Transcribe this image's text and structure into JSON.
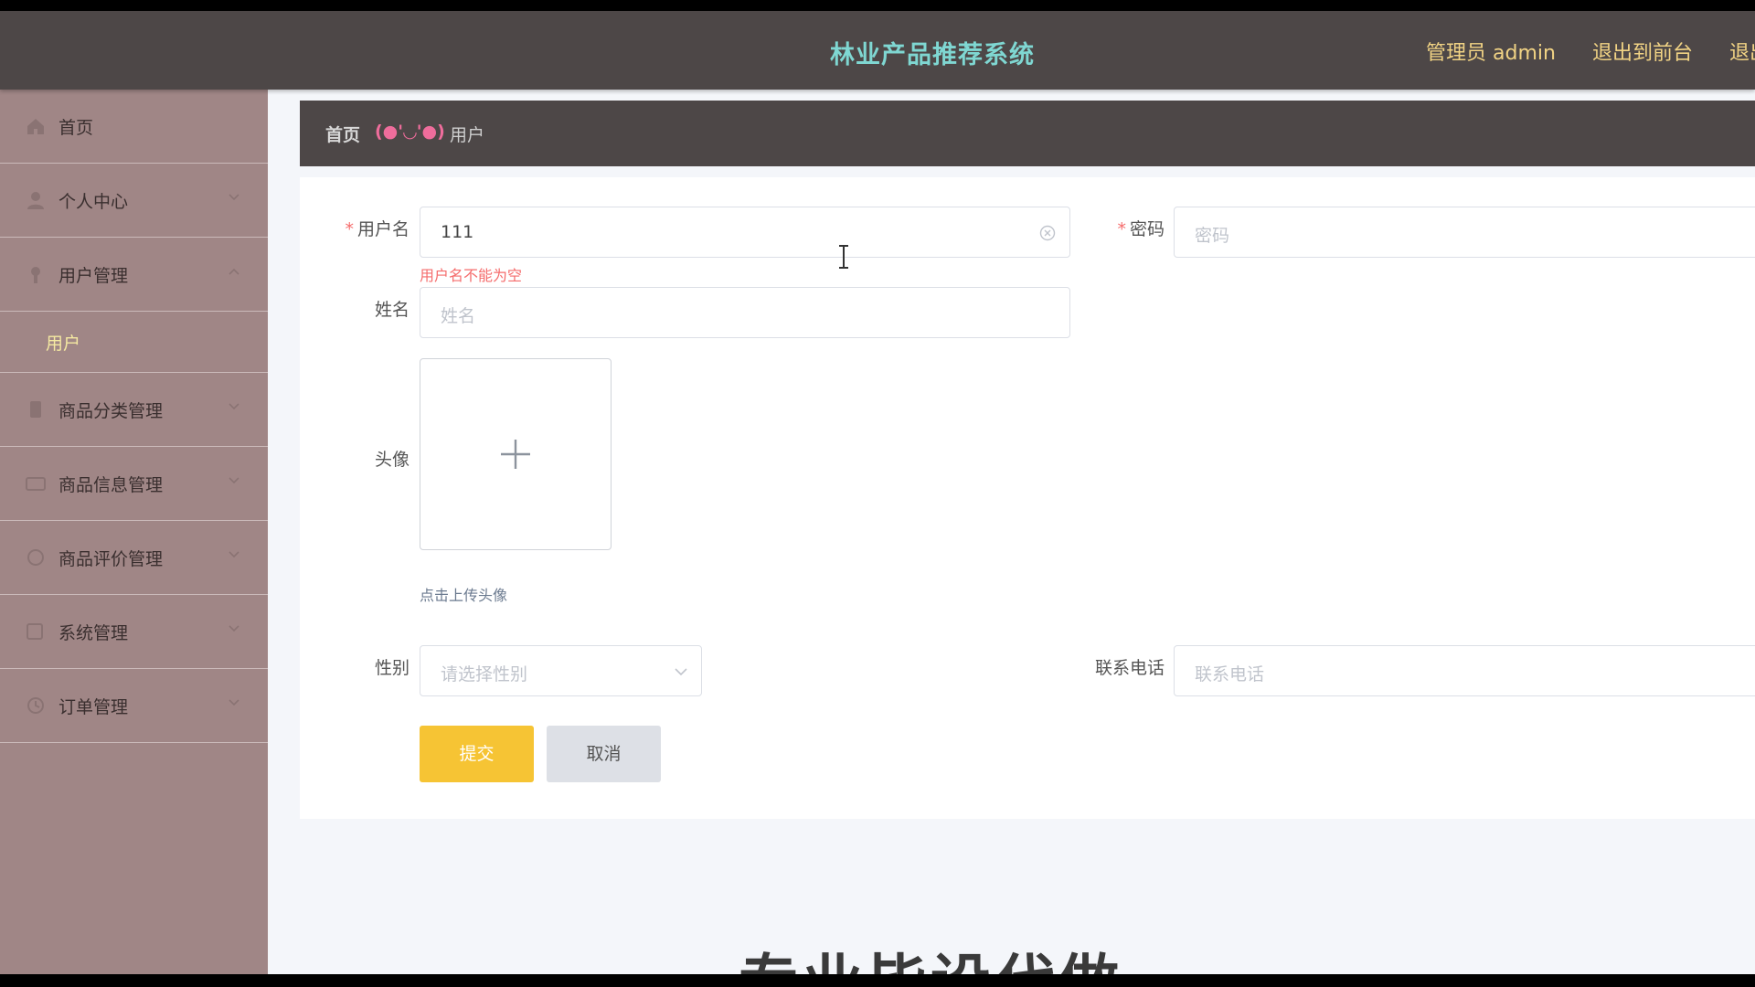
{
  "header": {
    "app_title": "林业产品推荐系统",
    "admin_label": "管理员 admin",
    "exit_to_front": "退出到前台",
    "logout": "退出登录"
  },
  "sidebar": {
    "items": [
      {
        "label": "首页",
        "icon": "home-icon"
      },
      {
        "label": "个人中心",
        "icon": "user-icon"
      },
      {
        "label": "用户管理",
        "icon": "users-icon",
        "expanded": true,
        "children": [
          {
            "label": "用户",
            "active": true
          }
        ]
      },
      {
        "label": "商品分类管理",
        "icon": "category-icon"
      },
      {
        "label": "商品信息管理",
        "icon": "goods-icon"
      },
      {
        "label": "商品评价管理",
        "icon": "comment-icon"
      },
      {
        "label": "系统管理",
        "icon": "system-icon"
      },
      {
        "label": "订单管理",
        "icon": "order-icon"
      }
    ]
  },
  "breadcrumb": {
    "home": "首页",
    "separator": "(●'◡'●)",
    "current": "用户"
  },
  "form": {
    "username": {
      "label": "用户名",
      "value": "111",
      "error": "用户名不能为空",
      "required": true
    },
    "password": {
      "label": "密码",
      "placeholder": "密码",
      "required": true
    },
    "name": {
      "label": "姓名",
      "placeholder": "姓名"
    },
    "avatar": {
      "label": "头像",
      "hint": "点击上传头像"
    },
    "gender": {
      "label": "性别",
      "placeholder": "请选择性别"
    },
    "phone": {
      "label": "联系电话",
      "placeholder": "联系电话"
    },
    "submit": "提交",
    "cancel": "取消"
  },
  "overlay": {
    "text": "专业毕设代做"
  },
  "colors": {
    "header_bg": "#4d4747",
    "title": "#7fd7d2",
    "header_link": "#f1d384",
    "sidebar_bg": "#a08686",
    "submenu_active": "#f5e9a2",
    "breadcrumb_sep": "#ef6d9c",
    "submit_bg": "#f6c434",
    "cancel_bg": "#dde0e6",
    "error": "#f56c6c"
  }
}
